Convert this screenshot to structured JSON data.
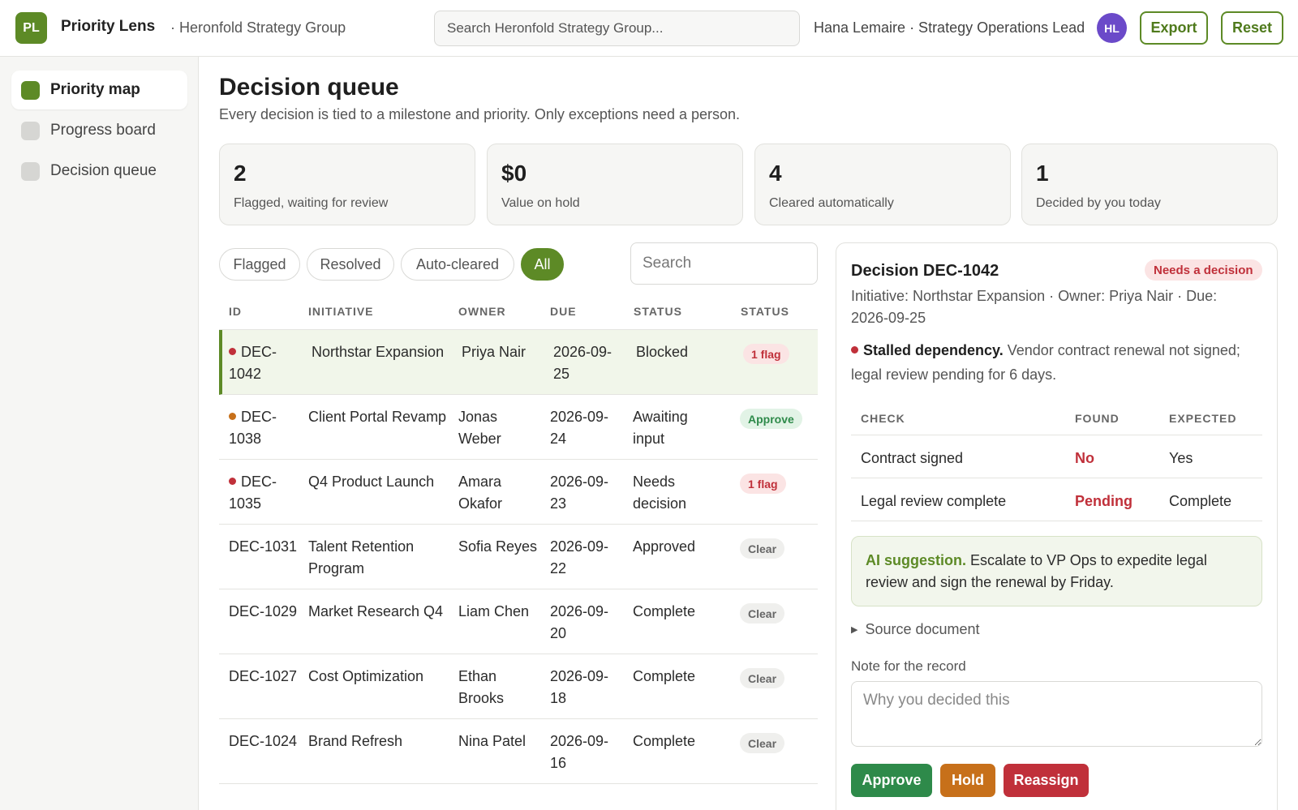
{
  "header": {
    "logo_initials": "PL",
    "app_name": "Priority Lens",
    "org": "· Heronfold Strategy Group",
    "search_placeholder": "Search Heronfold Strategy Group...",
    "user": "Hana Lemaire · Strategy Operations Lead",
    "avatar_initials": "HL",
    "export_label": "Export",
    "reset_label": "Reset"
  },
  "sidebar": {
    "items": [
      {
        "label": "Priority map",
        "active": true
      },
      {
        "label": "Progress board",
        "active": false
      },
      {
        "label": "Decision queue",
        "active": false
      }
    ]
  },
  "page": {
    "title": "Decision queue",
    "subtitle": "Every decision is tied to a milestone and priority. Only exceptions need a person."
  },
  "kpis": [
    {
      "value": "2",
      "label": "Flagged, waiting for review"
    },
    {
      "value": "$0",
      "label": "Value on hold"
    },
    {
      "value": "4",
      "label": "Cleared automatically"
    },
    {
      "value": "1",
      "label": "Decided by you today"
    }
  ],
  "filters": [
    {
      "label": "Flagged",
      "active": false
    },
    {
      "label": "Resolved",
      "active": false
    },
    {
      "label": "Auto-cleared",
      "active": false
    },
    {
      "label": "All",
      "active": true
    }
  ],
  "table_search_placeholder": "Search",
  "table": {
    "columns": [
      "ID",
      "INITIATIVE",
      "OWNER",
      "DUE",
      "STATUS",
      "STATUS"
    ],
    "rows": [
      {
        "id": "DEC-1042",
        "initiative": "Northstar Expansion",
        "owner": "Priya Nair",
        "due": "2026-09-25",
        "status": "Blocked",
        "badge": "1 flag",
        "badge_type": "flag",
        "dot": "#c0303a",
        "selected": true
      },
      {
        "id": "DEC-1038",
        "initiative": "Client Portal Revamp",
        "owner": "Jonas Weber",
        "due": "2026-09-24",
        "status": "Awaiting input",
        "badge": "Approve",
        "badge_type": "approve",
        "dot": "#c7701a",
        "selected": false
      },
      {
        "id": "DEC-1035",
        "initiative": "Q4 Product Launch",
        "owner": "Amara Okafor",
        "due": "2026-09-23",
        "status": "Needs decision",
        "badge": "1 flag",
        "badge_type": "flag",
        "dot": "#c0303a",
        "selected": false
      },
      {
        "id": "DEC-1031",
        "initiative": "Talent Retention Program",
        "owner": "Sofia Reyes",
        "due": "2026-09-22",
        "status": "Approved",
        "badge": "Clear",
        "badge_type": "clear",
        "dot": null,
        "selected": false
      },
      {
        "id": "DEC-1029",
        "initiative": "Market Research Q4",
        "owner": "Liam Chen",
        "due": "2026-09-20",
        "status": "Complete",
        "badge": "Clear",
        "badge_type": "clear",
        "dot": null,
        "selected": false
      },
      {
        "id": "DEC-1027",
        "initiative": "Cost Optimization",
        "owner": "Ethan Brooks",
        "due": "2026-09-18",
        "status": "Complete",
        "badge": "Clear",
        "badge_type": "clear",
        "dot": null,
        "selected": false
      },
      {
        "id": "DEC-1024",
        "initiative": "Brand Refresh",
        "owner": "Nina Patel",
        "due": "2026-09-16",
        "status": "Complete",
        "badge": "Clear",
        "badge_type": "clear",
        "dot": null,
        "selected": false
      }
    ]
  },
  "detail": {
    "title": "Decision DEC-1042",
    "badge": "Needs a decision",
    "meta": "Initiative: Northstar Expansion · Owner: Priya Nair · Due: 2026-09-25",
    "issue_title": "Stalled dependency.",
    "issue_text": "Vendor contract renewal not signed; legal review pending for 6 days.",
    "checks_columns": [
      "CHECK",
      "FOUND",
      "EXPECTED"
    ],
    "checks": [
      {
        "check": "Contract signed",
        "found": "No",
        "expected": "Yes"
      },
      {
        "check": "Legal review complete",
        "found": "Pending",
        "expected": "Complete"
      }
    ],
    "ai_title": "AI suggestion.",
    "ai_text": "Escalate to VP Ops to expedite legal review and sign the renewal by Friday.",
    "source_doc": "Source document",
    "note_label": "Note for the record",
    "note_placeholder": "Why you decided this",
    "actions": {
      "approve": "Approve",
      "hold": "Hold",
      "reassign": "Reassign"
    }
  },
  "colors": {
    "brand": "#5d8a26",
    "danger": "#c0303a",
    "warning": "#c7701a",
    "success": "#2e8a4a"
  }
}
